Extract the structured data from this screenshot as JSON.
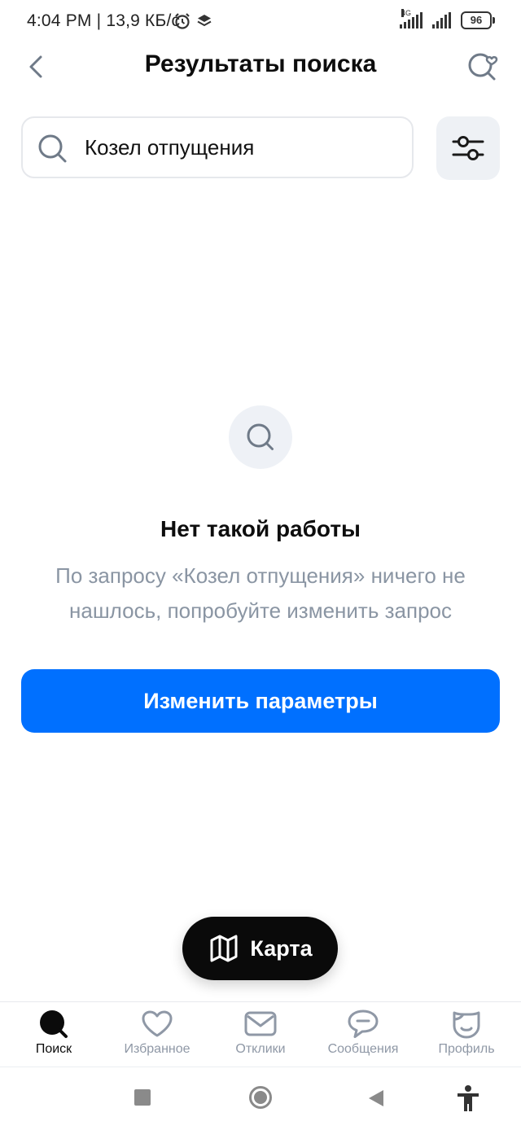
{
  "status_bar": {
    "time": "4:04 PM | 13,9 КБ/с",
    "network_tag": "4G",
    "battery": "96"
  },
  "header": {
    "title": "Результаты поиска"
  },
  "search": {
    "value": "Козел отпущения"
  },
  "empty_state": {
    "title": "Нет такой работы",
    "text": "По запросу «Козел отпущения» ничего не нашлось, попробуйте изменить запрос"
  },
  "actions": {
    "change_params": "Изменить параметры",
    "map": "Карта"
  },
  "bottom_nav": {
    "items": [
      {
        "label": "Поиск",
        "icon": "search-filled-icon",
        "active": true
      },
      {
        "label": "Избранное",
        "icon": "heart-icon",
        "active": false
      },
      {
        "label": "Отклики",
        "icon": "mail-icon",
        "active": false
      },
      {
        "label": "Сообщения",
        "icon": "chat-bubble-icon",
        "active": false
      },
      {
        "label": "Профиль",
        "icon": "profile-face-icon",
        "active": false
      }
    ]
  },
  "colors": {
    "accent": "#0070ff",
    "muted_text": "#8a95a3",
    "icon_gray": "#8f98a6"
  }
}
